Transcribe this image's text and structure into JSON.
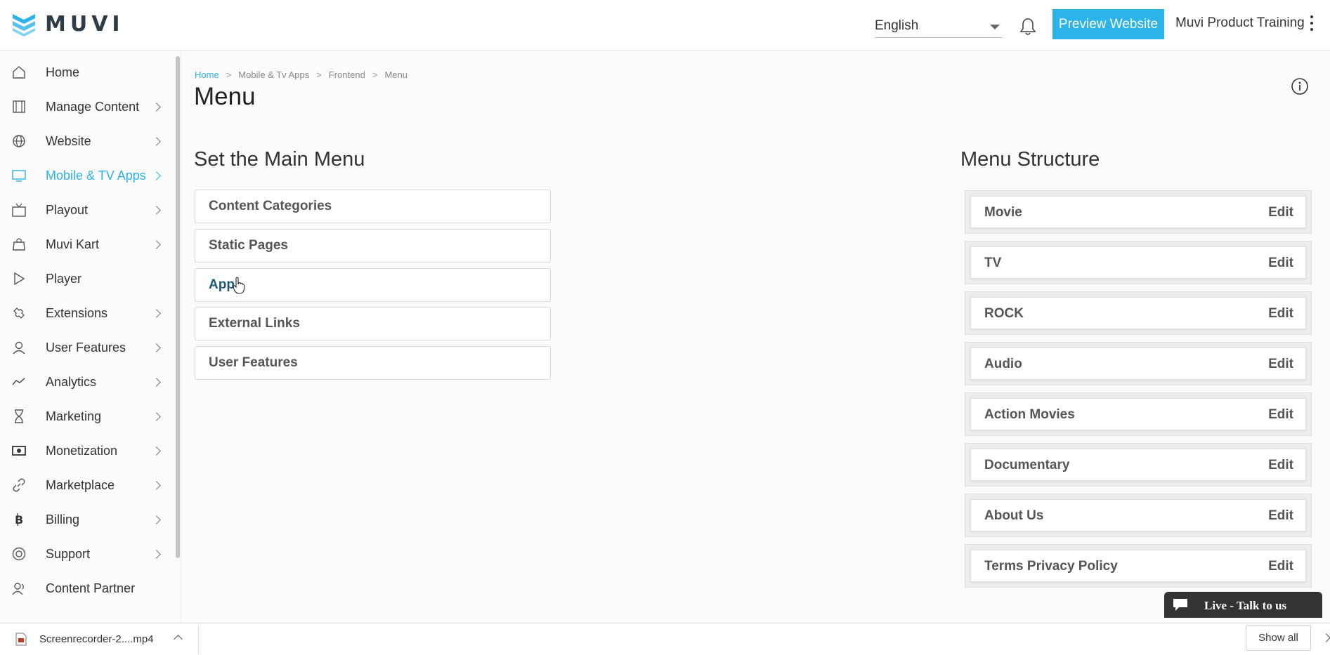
{
  "header": {
    "logo_text": "MUVI",
    "language": "English",
    "preview_button": "Preview Website",
    "user_name": "Muvi Product Training"
  },
  "sidebar": {
    "items": [
      {
        "label": "Home",
        "icon": "home-icon",
        "has_submenu": false
      },
      {
        "label": "Manage Content",
        "icon": "film-icon",
        "has_submenu": true
      },
      {
        "label": "Website",
        "icon": "globe-icon",
        "has_submenu": true
      },
      {
        "label": "Mobile & TV Apps",
        "icon": "monitor-icon",
        "has_submenu": true,
        "active": true
      },
      {
        "label": "Playout",
        "icon": "tv-icon",
        "has_submenu": true
      },
      {
        "label": "Muvi Kart",
        "icon": "shopping-bag-icon",
        "has_submenu": true
      },
      {
        "label": "Player",
        "icon": "play-icon",
        "has_submenu": false
      },
      {
        "label": "Extensions",
        "icon": "puzzle-icon",
        "has_submenu": true
      },
      {
        "label": "User Features",
        "icon": "user-icon",
        "has_submenu": true
      },
      {
        "label": "Analytics",
        "icon": "trend-icon",
        "has_submenu": true
      },
      {
        "label": "Marketing",
        "icon": "hourglass-icon",
        "has_submenu": true
      },
      {
        "label": "Monetization",
        "icon": "money-icon",
        "has_submenu": true
      },
      {
        "label": "Marketplace",
        "icon": "link-icon",
        "has_submenu": true
      },
      {
        "label": "Billing",
        "icon": "bitcoin-icon",
        "has_submenu": true
      },
      {
        "label": "Support",
        "icon": "lifebuoy-icon",
        "has_submenu": true
      },
      {
        "label": "Content Partner",
        "icon": "partner-icon",
        "has_submenu": false
      }
    ]
  },
  "breadcrumb": [
    "Home",
    "Mobile & Tv Apps",
    "Frontend",
    "Menu"
  ],
  "page_title": "Menu",
  "main_menu": {
    "title": "Set the Main Menu",
    "options": [
      "Content Categories",
      "Static Pages",
      "App",
      "External Links",
      "User Features"
    ]
  },
  "menu_structure": {
    "title": "Menu Structure",
    "edit_label": "Edit",
    "items": [
      "Movie",
      "TV",
      "ROCK",
      "Audio",
      "Action Movies",
      "Documentary",
      "About Us",
      "Terms Privacy Policy"
    ]
  },
  "live_chat": {
    "label": "Live - Talk to us"
  },
  "download_bar": {
    "file_name": "Screenrecorder-2....mp4",
    "show_all": "Show all"
  },
  "colors": {
    "accent": "#2bb3ea",
    "text": "#333333",
    "chat_bg": "#333333"
  }
}
